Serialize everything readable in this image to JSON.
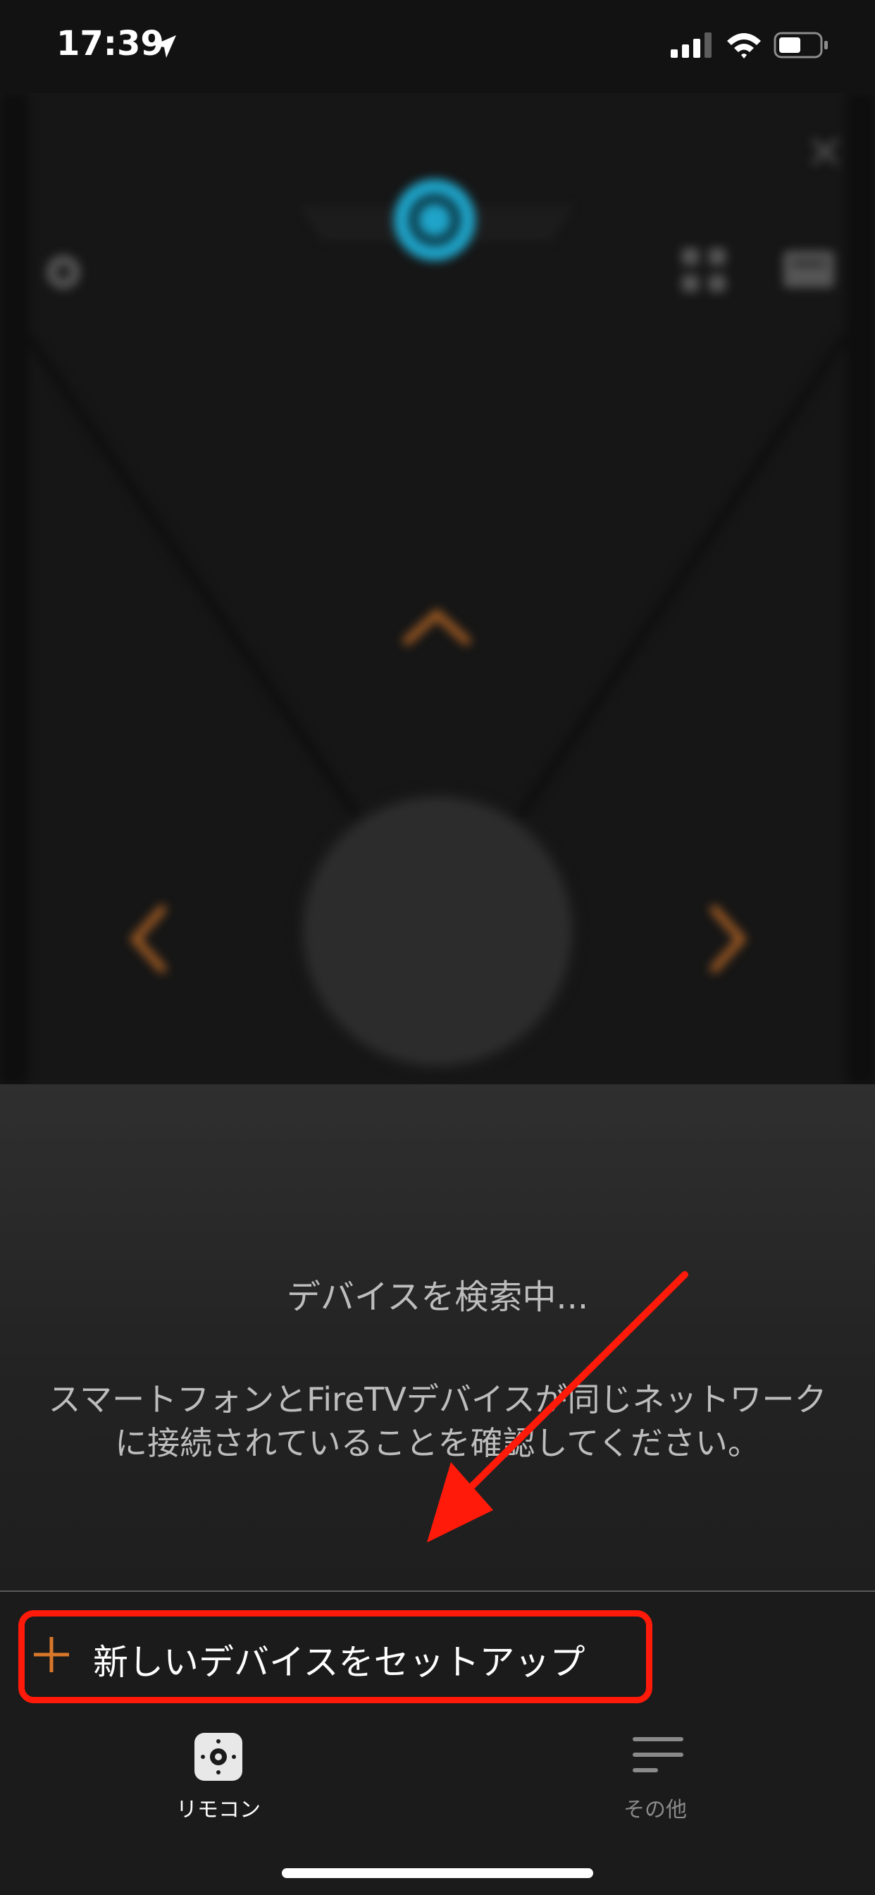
{
  "status_bar": {
    "time": "17:39"
  },
  "search": {
    "title": "デバイスを検索中...",
    "message": "スマートフォンとFireTVデバイスが同じネットワークに接続されていることを確認してください。"
  },
  "setup": {
    "label": "新しいデバイスをセットアップ"
  },
  "tabs": [
    {
      "label": "リモコン",
      "icon": "remote-icon",
      "selected": true
    },
    {
      "label": "その他",
      "icon": "menu-icon",
      "selected": false
    }
  ],
  "icons": {
    "close": "close-icon",
    "alexa": "alexa-icon",
    "settings": "gear-icon",
    "apps": "apps-icon",
    "input": "input-icon",
    "plus": "plus-icon"
  },
  "colors": {
    "accent": "#d9772a",
    "alexa_blue": "#1fa3c8",
    "annotation_red": "#ff1a0a",
    "background": "#161616"
  }
}
